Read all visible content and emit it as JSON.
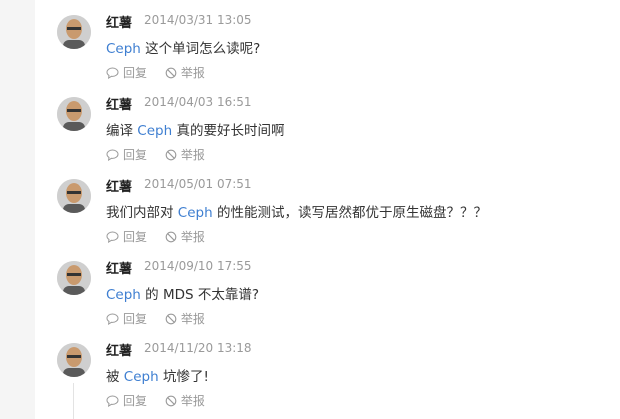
{
  "comments": [
    {
      "author": "红薯",
      "time": "2014/03/31 13:05",
      "body": {
        "pre": "",
        "kw": "Ceph",
        "post": " 这个单词怎么读呢?"
      },
      "reply_label": "回复",
      "report_label": "举报"
    },
    {
      "author": "红薯",
      "time": "2014/04/03 16:51",
      "body": {
        "pre": "编译 ",
        "kw": "Ceph",
        "post": " 真的要好长时间啊"
      },
      "reply_label": "回复",
      "report_label": "举报"
    },
    {
      "author": "红薯",
      "time": "2014/05/01 07:51",
      "body": {
        "pre": "我们内部对 ",
        "kw": "Ceph",
        "post": " 的性能测试，读写居然都优于原生磁盘？？？"
      },
      "reply_label": "回复",
      "report_label": "举报"
    },
    {
      "author": "红薯",
      "time": "2014/09/10 17:55",
      "body": {
        "pre": "",
        "kw": "Ceph",
        "post": " 的 MDS 不太靠谱?"
      },
      "reply_label": "回复",
      "report_label": "举报"
    },
    {
      "author": "红薯",
      "time": "2014/11/20 13:18",
      "body": {
        "pre": "被 ",
        "kw": "Ceph",
        "post": " 坑惨了!"
      },
      "reply_label": "回复",
      "report_label": "举报"
    }
  ],
  "icons": {
    "reply": "comment-bubble-icon",
    "report": "block-icon"
  },
  "colors": {
    "keyword": "#3f7fd1",
    "meta": "#9a9a9a",
    "text": "#333333"
  }
}
